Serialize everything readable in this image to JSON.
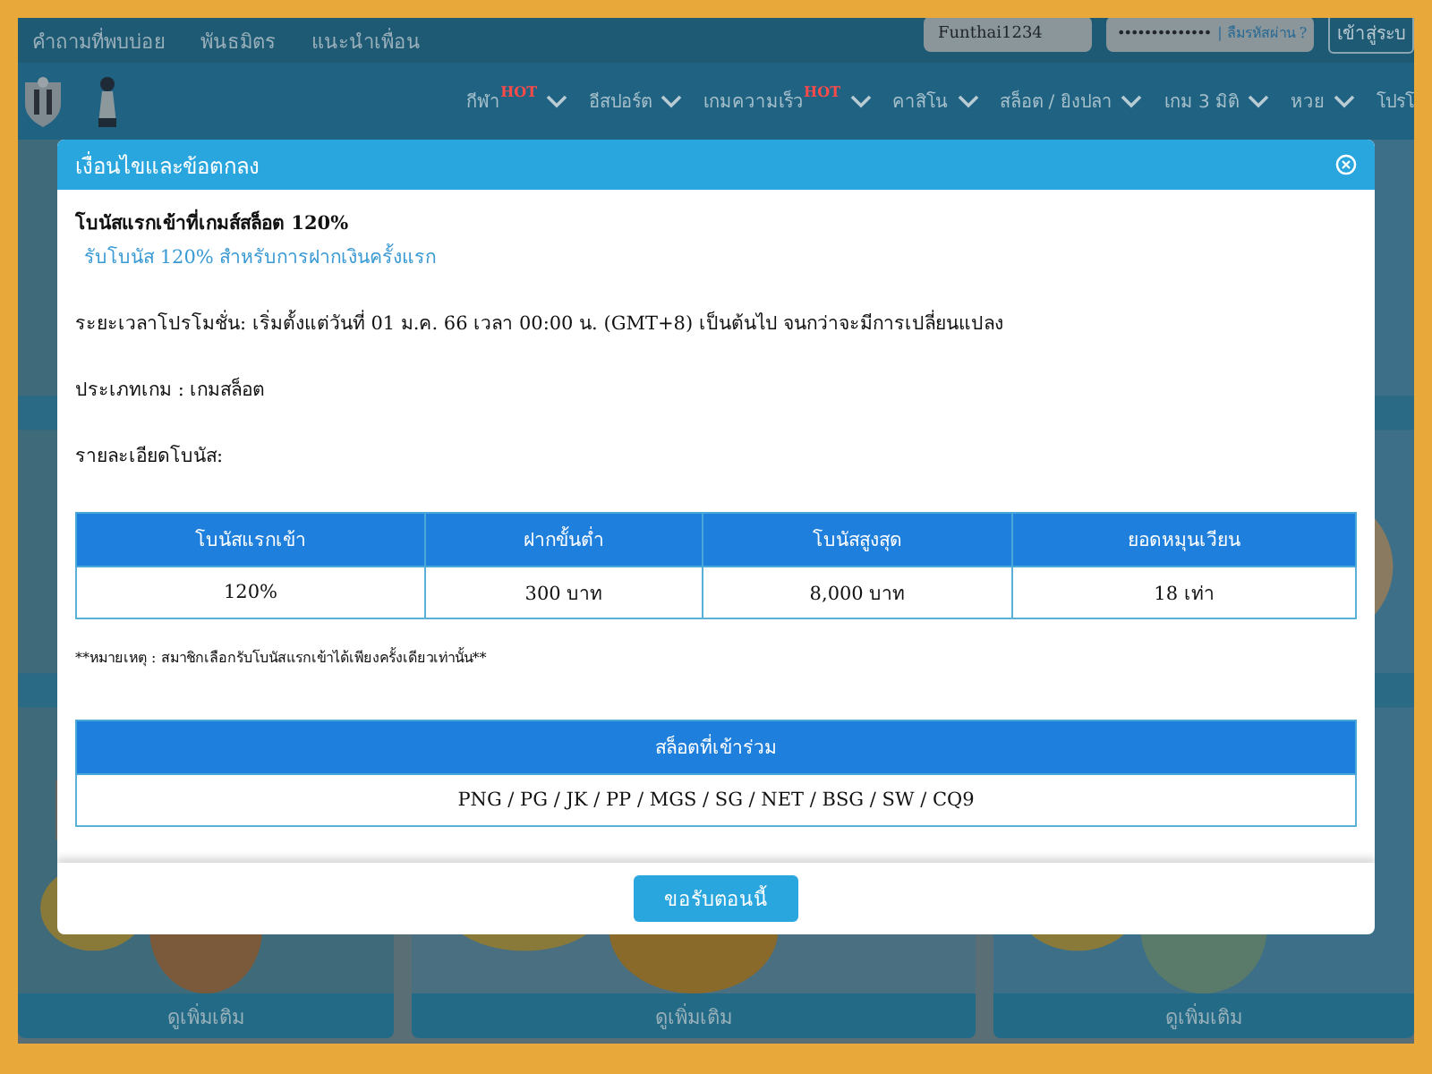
{
  "top_bar": {
    "links": [
      "คำถามที่พบบ่อย",
      "พันธมิตร",
      "แนะนำเพื่อน"
    ],
    "username": {
      "value": "Funthai1234"
    },
    "password": {
      "value": "••••••••••••••",
      "forgot_link": "| ลืมรหัสผ่าน ?"
    },
    "login_button": "เข้าสู่ระบ"
  },
  "nav": {
    "items": [
      {
        "label": "กีฬา",
        "badge": "HOT"
      },
      {
        "label": "อีสปอร์ต"
      },
      {
        "label": "เกมความเร็ว",
        "badge": "HOT"
      },
      {
        "label": "คาสิโน"
      },
      {
        "label": "สล็อต / ยิงปลา"
      },
      {
        "label": "เกม 3 มิติ"
      },
      {
        "label": "หวย"
      },
      {
        "label": "โปรโ"
      }
    ]
  },
  "cards": [
    {
      "button": "ดูเพิ่มเติม"
    },
    {
      "button": "ดูเพิ่มเติม"
    },
    {
      "button": "ดูเพิ่มเติม"
    }
  ],
  "modal": {
    "title": "เงื่อนไขและข้อตกลง",
    "promo_title": "โบนัสแรกเข้าที่เกมส์สล็อต 120%",
    "subtitle": "รับโบนัส 120% สำหรับการฝากเงินครั้งแรก",
    "period": "ระยะเวลาโปรโมชั่น: เริ่มตั้งแต่วันที่ 01 ม.ค. 66 เวลา 00:00 น. (GMT+8) เป็นต้นไป จนกว่าจะมีการเปลี่ยนแปลง",
    "game_type": "ประเภทเกม : เกมสล็อต",
    "details_label": "รายละเอียดโบนัส:",
    "bonus_table": {
      "columns": [
        "โบนัสแรกเข้า",
        "ฝากขั้นต่ำ",
        "โบนัสสูงสุด",
        "ยอดหมุนเวียน"
      ],
      "rows": [
        [
          "120%",
          "300 บาท",
          "8,000 บาท",
          "18 เท่า"
        ]
      ]
    },
    "note": "**หมายเหตุ : สมาชิกเลือกรับโบนัสแรกเข้าได้เพียงครั้งเดียวเท่านั้น**",
    "providers_table": {
      "heading": "สล็อตที่เข้าร่วม",
      "row": "PNG / PG / JK / PP / MGS / SG / NET / BSG / SW / CQ9"
    },
    "claim_button": "ขอรับตอนนี้"
  }
}
